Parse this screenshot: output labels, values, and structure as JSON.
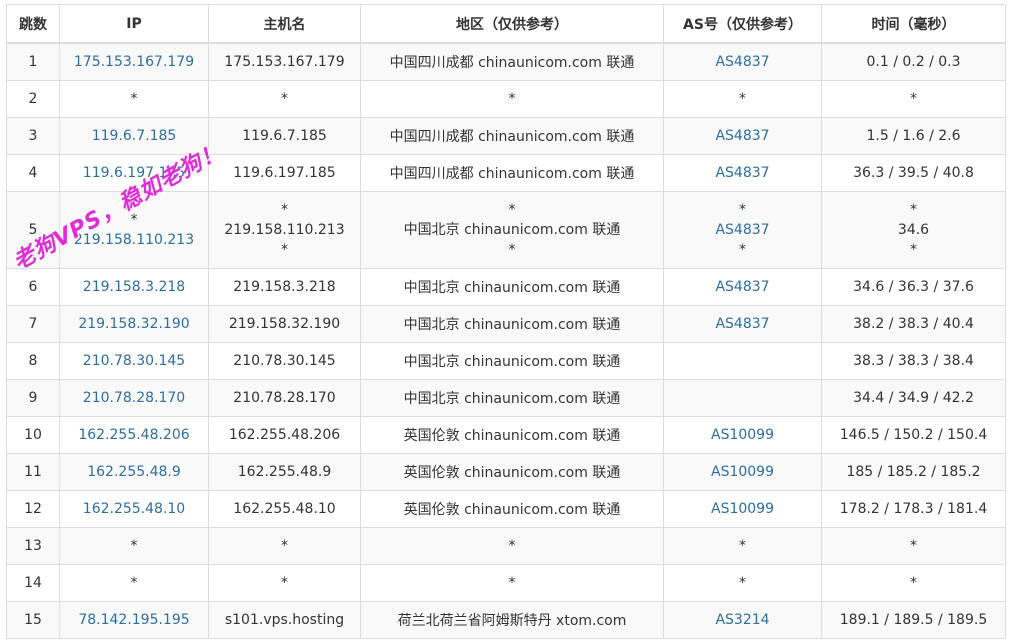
{
  "headers": [
    "跳数",
    "IP",
    "主机名",
    "地区（仅供参考）",
    "AS号（仅供参考）",
    "时间（毫秒）"
  ],
  "rows": [
    {
      "hop": "1",
      "ip": [
        "175.153.167.179"
      ],
      "host": [
        "175.153.167.179"
      ],
      "region": [
        "中国四川成都 chinaunicom.com 联通"
      ],
      "asn": [
        "AS4837"
      ],
      "time": [
        "0.1 / 0.2 / 0.3"
      ]
    },
    {
      "hop": "2",
      "ip": [
        "*"
      ],
      "host": [
        "*"
      ],
      "region": [
        "*"
      ],
      "asn": [
        "*"
      ],
      "time": [
        "*"
      ]
    },
    {
      "hop": "3",
      "ip": [
        "119.6.7.185"
      ],
      "host": [
        "119.6.7.185"
      ],
      "region": [
        "中国四川成都 chinaunicom.com 联通"
      ],
      "asn": [
        "AS4837"
      ],
      "time": [
        "1.5 / 1.6 / 2.6"
      ]
    },
    {
      "hop": "4",
      "ip": [
        "119.6.197.185"
      ],
      "host": [
        "119.6.197.185"
      ],
      "region": [
        "中国四川成都 chinaunicom.com 联通"
      ],
      "asn": [
        "AS4837"
      ],
      "time": [
        "36.3 / 39.5 / 40.8"
      ]
    },
    {
      "hop": "5",
      "ip": [
        "*",
        "219.158.110.213"
      ],
      "host": [
        "*",
        "219.158.110.213",
        "*"
      ],
      "region": [
        "*",
        "中国北京 chinaunicom.com 联通",
        "*"
      ],
      "asn": [
        "*",
        "AS4837",
        "*"
      ],
      "time": [
        "*",
        "34.6",
        "*"
      ]
    },
    {
      "hop": "6",
      "ip": [
        "219.158.3.218"
      ],
      "host": [
        "219.158.3.218"
      ],
      "region": [
        "中国北京 chinaunicom.com 联通"
      ],
      "asn": [
        "AS4837"
      ],
      "time": [
        "34.6 / 36.3 / 37.6"
      ]
    },
    {
      "hop": "7",
      "ip": [
        "219.158.32.190"
      ],
      "host": [
        "219.158.32.190"
      ],
      "region": [
        "中国北京 chinaunicom.com 联通"
      ],
      "asn": [
        "AS4837"
      ],
      "time": [
        "38.2 / 38.3 / 40.4"
      ]
    },
    {
      "hop": "8",
      "ip": [
        "210.78.30.145"
      ],
      "host": [
        "210.78.30.145"
      ],
      "region": [
        "中国北京 chinaunicom.com 联通"
      ],
      "asn": [
        ""
      ],
      "time": [
        "38.3 / 38.3 / 38.4"
      ]
    },
    {
      "hop": "9",
      "ip": [
        "210.78.28.170"
      ],
      "host": [
        "210.78.28.170"
      ],
      "region": [
        "中国北京 chinaunicom.com 联通"
      ],
      "asn": [
        ""
      ],
      "time": [
        "34.4 / 34.9 / 42.2"
      ]
    },
    {
      "hop": "10",
      "ip": [
        "162.255.48.206"
      ],
      "host": [
        "162.255.48.206"
      ],
      "region": [
        "英国伦敦 chinaunicom.com 联通"
      ],
      "asn": [
        "AS10099"
      ],
      "time": [
        "146.5 / 150.2 / 150.4"
      ]
    },
    {
      "hop": "11",
      "ip": [
        "162.255.48.9"
      ],
      "host": [
        "162.255.48.9"
      ],
      "region": [
        "英国伦敦 chinaunicom.com 联通"
      ],
      "asn": [
        "AS10099"
      ],
      "time": [
        "185 / 185.2 / 185.2"
      ]
    },
    {
      "hop": "12",
      "ip": [
        "162.255.48.10"
      ],
      "host": [
        "162.255.48.10"
      ],
      "region": [
        "英国伦敦 chinaunicom.com 联通"
      ],
      "asn": [
        "AS10099"
      ],
      "time": [
        "178.2 / 178.3 / 181.4"
      ]
    },
    {
      "hop": "13",
      "ip": [
        "*"
      ],
      "host": [
        "*"
      ],
      "region": [
        "*"
      ],
      "asn": [
        "*"
      ],
      "time": [
        "*"
      ]
    },
    {
      "hop": "14",
      "ip": [
        "*"
      ],
      "host": [
        "*"
      ],
      "region": [
        "*"
      ],
      "asn": [
        "*"
      ],
      "time": [
        "*"
      ]
    },
    {
      "hop": "15",
      "ip": [
        "78.142.195.195"
      ],
      "host": [
        "s101.vps.hosting"
      ],
      "region": [
        "荷兰北荷兰省阿姆斯特丹 xtom.com"
      ],
      "asn": [
        "AS3214"
      ],
      "time": [
        "189.1 / 189.5 / 189.5"
      ]
    }
  ],
  "watermark": "老狗VPS，稳如老狗！",
  "colors": {
    "link": "#2f6d9c",
    "watermark": "#e02bd6",
    "border": "#dddddd",
    "stripe": "#f9f9f9"
  }
}
